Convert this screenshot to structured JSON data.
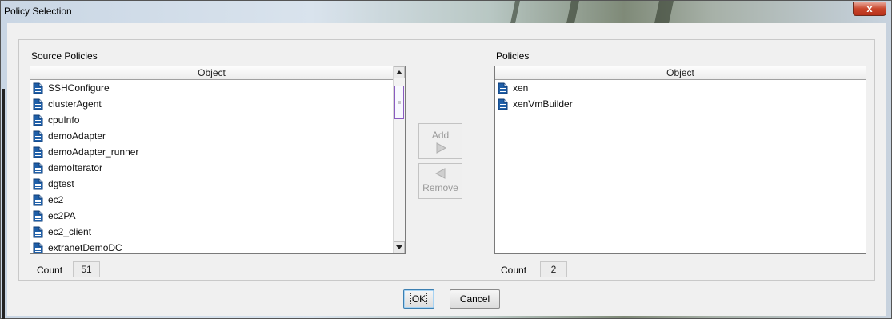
{
  "window": {
    "title": "Policy Selection",
    "close_symbol": "x"
  },
  "source": {
    "section_label": "Source Policies",
    "column_header": "Object",
    "items": [
      "SSHConfigure",
      "clusterAgent",
      "cpuInfo",
      "demoAdapter",
      "demoAdapter_runner",
      "demoIterator",
      "dgtest",
      "ec2",
      "ec2PA",
      "ec2_client",
      "extranetDemoDC"
    ],
    "count_label": "Count",
    "count_value": "51"
  },
  "target": {
    "section_label": "Policies",
    "column_header": "Object",
    "items": [
      "xen",
      "xenVmBuilder"
    ],
    "count_label": "Count",
    "count_value": "2"
  },
  "transfer": {
    "add_label": "Add",
    "remove_label": "Remove"
  },
  "footer": {
    "ok_label": "OK",
    "cancel_label": "Cancel"
  },
  "colors": {
    "scroll_thumb_border": "#8a5bc0",
    "icon_blue": "#1f5fa8",
    "close_red": "#c9462c"
  }
}
